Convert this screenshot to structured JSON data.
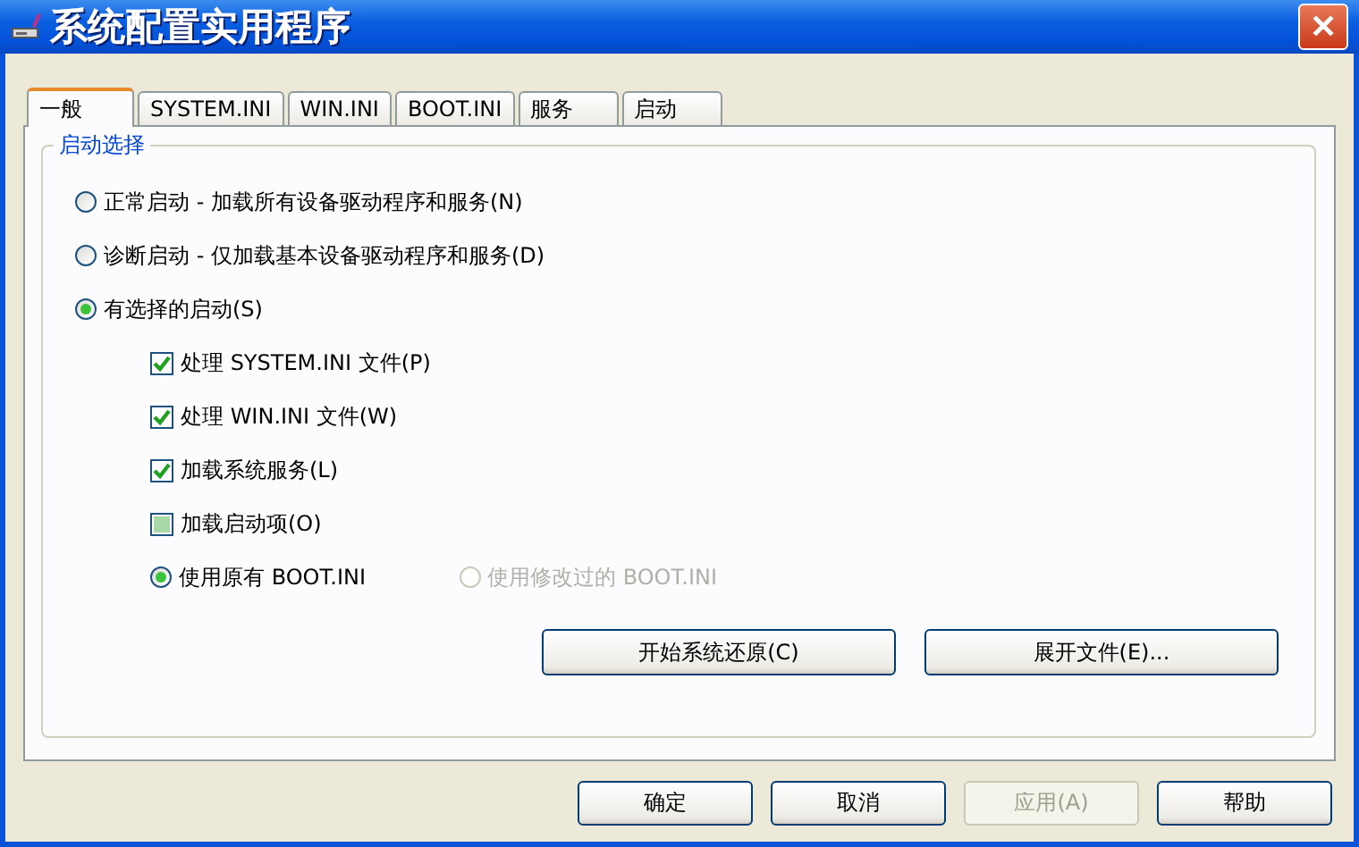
{
  "window": {
    "title": "系统配置实用程序",
    "close": "✕"
  },
  "tabs": [
    {
      "label": "一般",
      "selected": true
    },
    {
      "label": "SYSTEM.INI",
      "selected": false
    },
    {
      "label": "WIN.INI",
      "selected": false
    },
    {
      "label": "BOOT.INI",
      "selected": false
    },
    {
      "label": "服务",
      "selected": false
    },
    {
      "label": "启动",
      "selected": false
    }
  ],
  "group": {
    "title": "启动选择",
    "modes": [
      {
        "label": "正常启动 - 加载所有设备驱动程序和服务(N)",
        "selected": false
      },
      {
        "label": "诊断启动 - 仅加载基本设备驱动程序和服务(D)",
        "selected": false
      },
      {
        "label": "有选择的启动(S)",
        "selected": true
      }
    ],
    "options": [
      {
        "label": "处理 SYSTEM.INI 文件(P)",
        "checked": true,
        "indeterminate": false
      },
      {
        "label": "处理 WIN.INI 文件(W)",
        "checked": true,
        "indeterminate": false
      },
      {
        "label": "加载系统服务(L)",
        "checked": true,
        "indeterminate": false
      },
      {
        "label": "加载启动项(O)",
        "checked": false,
        "indeterminate": true
      }
    ],
    "boot": [
      {
        "label": "使用原有 BOOT.INI",
        "selected": true,
        "disabled": false
      },
      {
        "label": "使用修改过的 BOOT.INI",
        "selected": false,
        "disabled": true
      }
    ],
    "buttons": [
      "开始系统还原(C)",
      "展开文件(E)..."
    ]
  },
  "buttons": [
    {
      "label": "确定",
      "disabled": false
    },
    {
      "label": "取消",
      "disabled": false
    },
    {
      "label": "应用(A)",
      "disabled": true
    },
    {
      "label": "帮助",
      "disabled": false
    }
  ]
}
